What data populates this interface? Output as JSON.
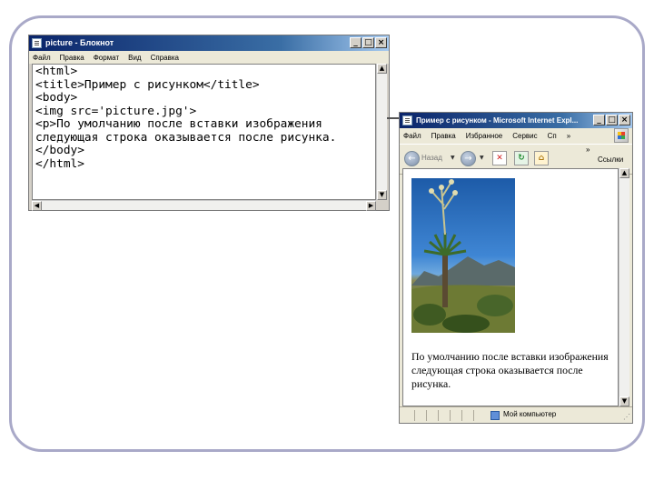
{
  "notepad": {
    "title": "picture - Блокнот",
    "window_buttons": [
      "_",
      "□",
      "×"
    ],
    "menu": [
      "Файл",
      "Правка",
      "Формат",
      "Вид",
      "Справка"
    ],
    "lines": [
      "<html>",
      "<title>Пример с рисунком</title>",
      "<body>",
      "<img src='picture.jpg'>",
      "<p>По умолчанию после вставки изображения",
      "следующая строка оказывается после рисунка.",
      "</body>",
      "</html>"
    ]
  },
  "ie": {
    "title": "Пример с рисунком - Microsoft Internet Expl...",
    "window_buttons": [
      "_",
      "□",
      "×"
    ],
    "menu": [
      "Файл",
      "Правка",
      "Избранное",
      "Сервис",
      "Сп"
    ],
    "toolbar": {
      "back_label": "Назад",
      "links_label": "Ссылки"
    },
    "page_text": "По умолчанию после вставки изображения следующая строка оказывается после рисунка.",
    "status": "Мой компьютер"
  }
}
